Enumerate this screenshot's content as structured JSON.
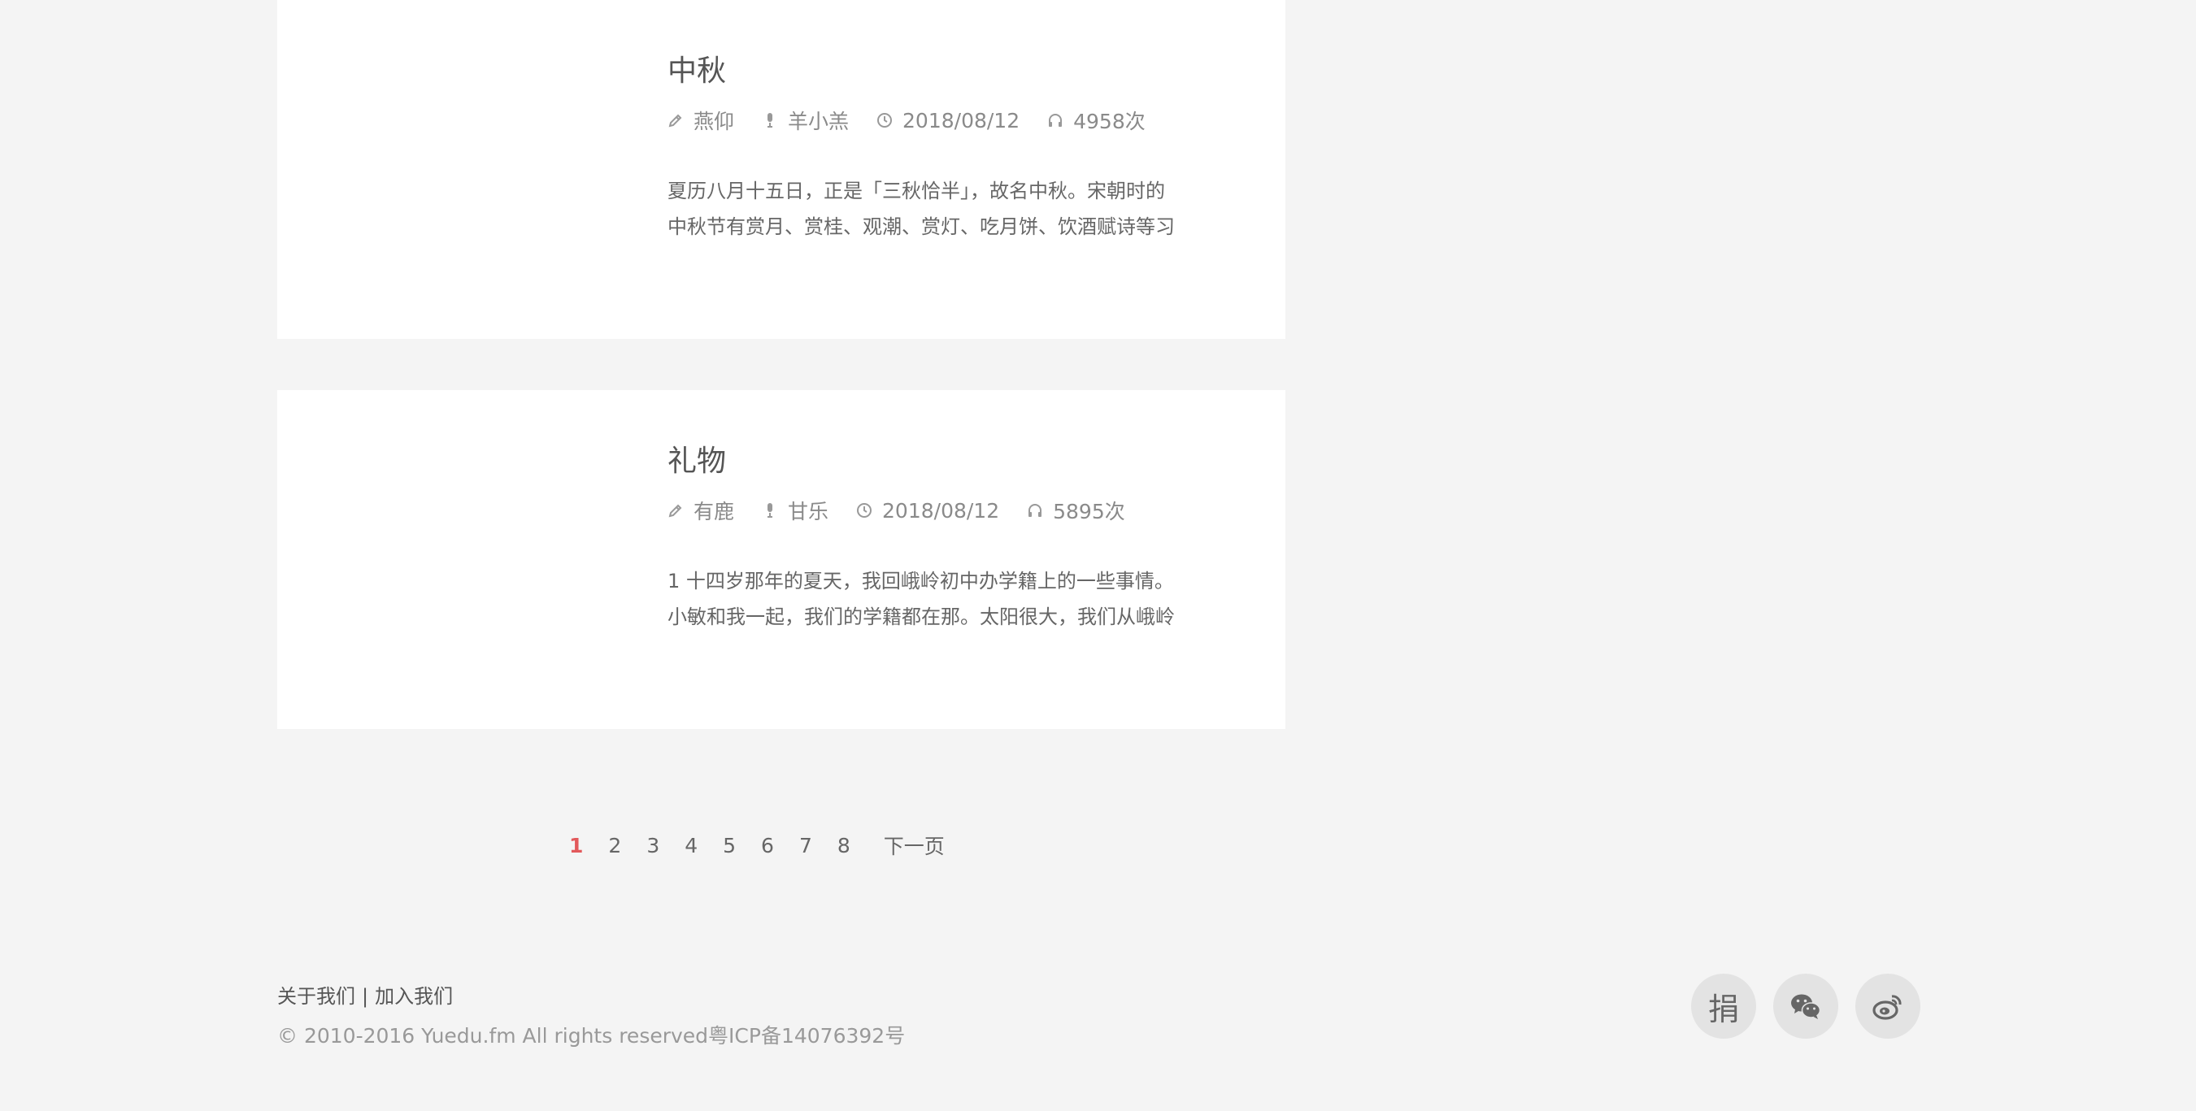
{
  "posts": [
    {
      "title": "中秋",
      "author": "燕仰",
      "narrator": "羊小羔",
      "date": "2018/08/12",
      "plays": "4958次",
      "summary_line1": "夏历八月十五日，正是「三秋恰半」，故名中秋。宋朝时的",
      "summary_line2": "中秋节有赏月、赏桂、观潮、赏灯、吃月饼、饮酒赋诗等习"
    },
    {
      "title": "礼物",
      "author": "有鹿",
      "narrator": "甘乐",
      "date": "2018/08/12",
      "plays": "5895次",
      "summary_line1": "1 十四岁那年的夏天，我回峨岭初中办学籍上的一些事情。",
      "summary_line2": "小敏和我一起，我们的学籍都在那。太阳很大，我们从峨岭"
    }
  ],
  "pagination": {
    "pages": [
      "1",
      "2",
      "3",
      "4",
      "5",
      "6",
      "7",
      "8"
    ],
    "current": "1",
    "next_label": "下一页",
    "active_color": "#e2595b"
  },
  "footer": {
    "about_label": "关于我们",
    "separator": "|",
    "join_label": "加入我们",
    "copyright": "© 2010-2016 Yuedu.fm All rights reserved粤ICP备14076392号"
  },
  "social": {
    "donate_label": "捐",
    "icons": [
      "donate-icon",
      "wechat-icon",
      "weibo-icon"
    ]
  },
  "icons": {
    "author": "pencil-icon",
    "narrator": "microphone-icon",
    "date": "clock-icon",
    "plays": "headphones-icon"
  }
}
